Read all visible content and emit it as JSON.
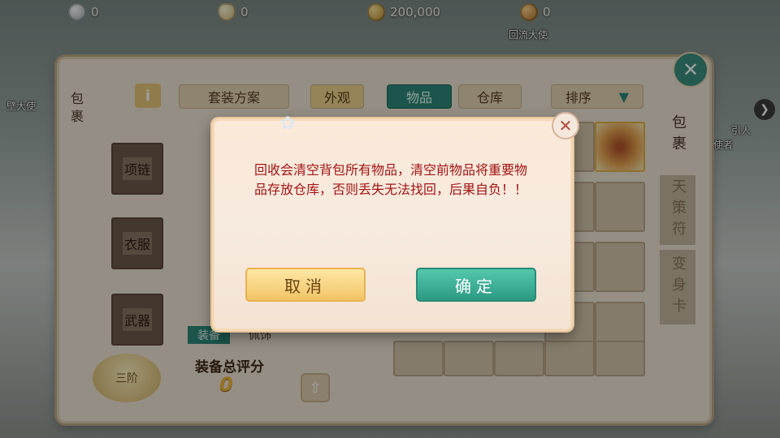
{
  "resources": [
    {
      "icon": "silver-coin-icon",
      "value": "0"
    },
    {
      "icon": "ingot-icon",
      "value": "0"
    },
    {
      "icon": "gold-coin-icon",
      "value": "200,000"
    },
    {
      "icon": "bag-icon",
      "value": "0"
    }
  ],
  "npc_labels": {
    "top_center": "回流大使",
    "left": "壁大使",
    "right_top": "引人",
    "right_bottom": "武使者"
  },
  "inventory": {
    "left_tab": "包裹",
    "info_glyph": "i",
    "tabs": {
      "outfit_plan": "套装方案",
      "appearance": "外观",
      "items": "物品",
      "warehouse": "仓库",
      "sort": "排序"
    },
    "equip_slots": [
      "项链",
      "衣服",
      "武器"
    ],
    "subtabs": [
      "装备",
      "佩饰"
    ],
    "score_label": "装备总评分",
    "score_value": "0",
    "grade_badge": "三阶",
    "right_tabs": [
      "包裹",
      "天策符",
      "变身卡"
    ]
  },
  "dialog": {
    "message": "回收会清空背包所有物品，清空前物品将重要物品存放仓库，否则丢失无法找回，后果自负！！",
    "cancel_label": "取消",
    "confirm_label": "确定"
  }
}
